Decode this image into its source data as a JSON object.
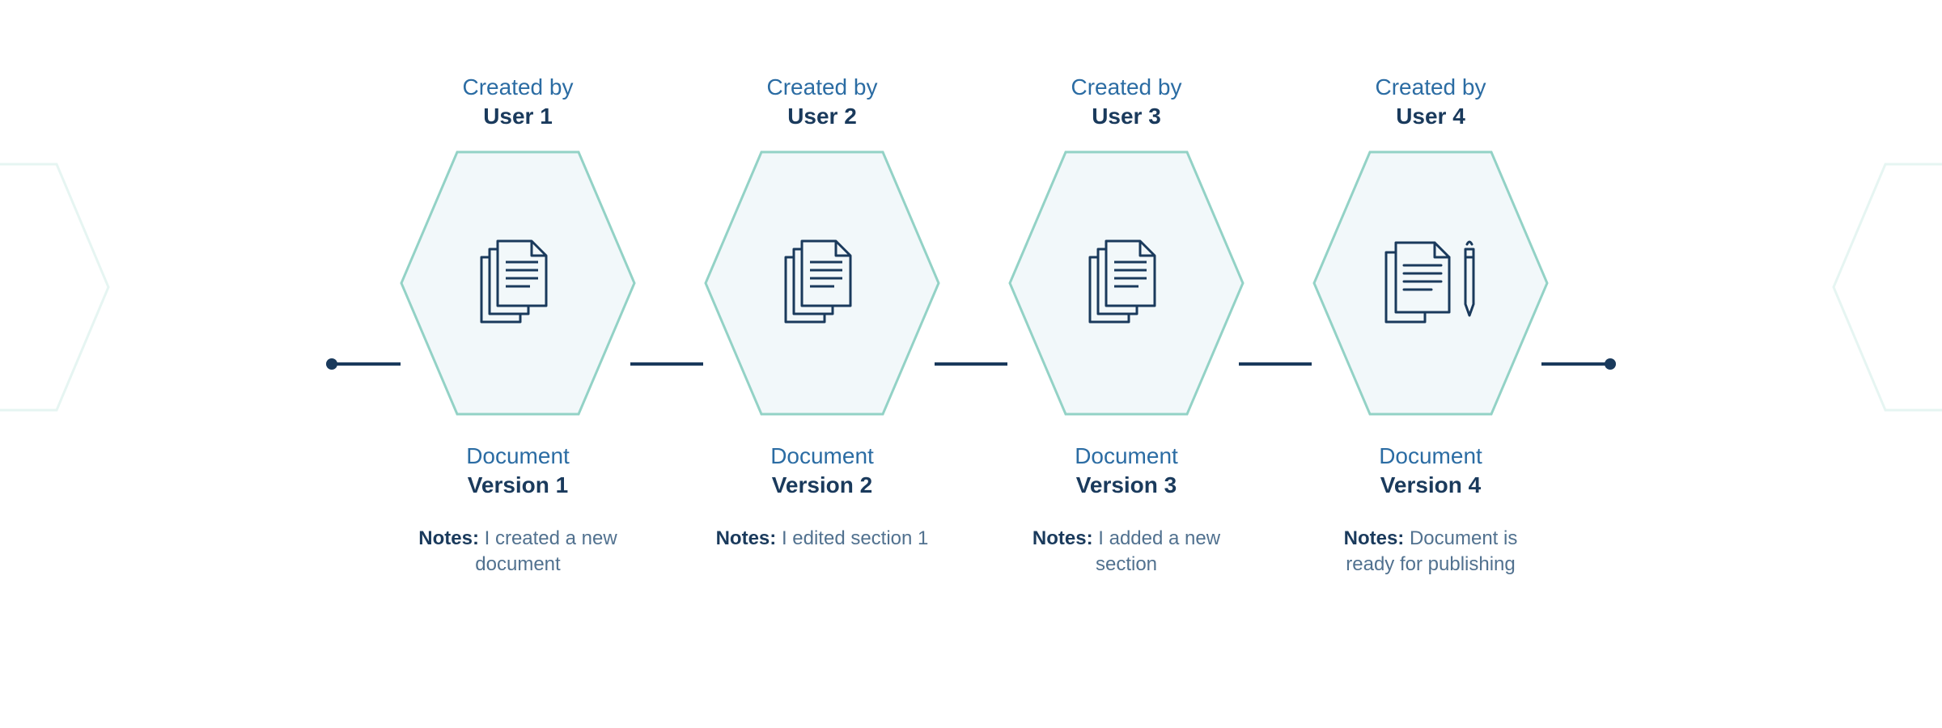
{
  "colors": {
    "line": "#1a3a5c",
    "hexStroke": "#93d2c6",
    "hexFill": "#f2f8fa",
    "textLight": "#2b6ca3",
    "textDark": "#1a3a5c",
    "notesText": "#51718f"
  },
  "labels": {
    "createdBy": "Created by",
    "document": "Document",
    "notes": "Notes:"
  },
  "versions": [
    {
      "user": "User 1",
      "version": "Version 1",
      "icon": "document-stack-icon",
      "note": "I created a new document"
    },
    {
      "user": "User 2",
      "version": "Version 2",
      "icon": "document-stack-icon",
      "note": "I edited section 1"
    },
    {
      "user": "User 3",
      "version": "Version 3",
      "icon": "document-stack-icon",
      "note": "I added a new section"
    },
    {
      "user": "User 4",
      "version": "Version 4",
      "icon": "document-pen-icon",
      "note": "Document is ready for publishing"
    }
  ]
}
